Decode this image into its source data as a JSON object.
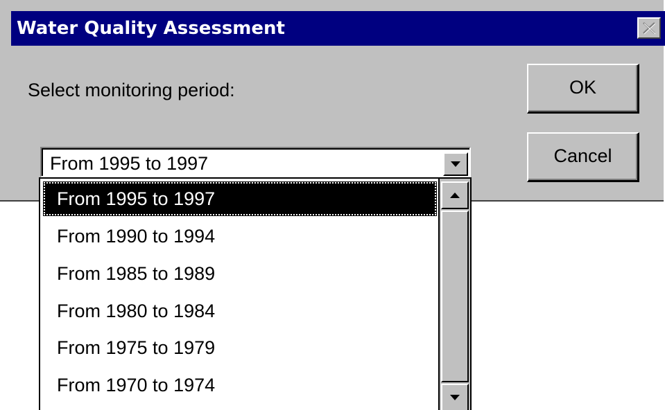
{
  "window": {
    "title": "Water Quality Assessment",
    "title_bar_color": "#000080",
    "close_icon": "close-icon"
  },
  "prompt": {
    "label": "Select monitoring period:"
  },
  "buttons": {
    "ok_label": "OK",
    "cancel_label": "Cancel"
  },
  "combo": {
    "selected_value": "From 1995 to 1997",
    "arrow_icon": "chevron-down-icon"
  },
  "dropdown": {
    "items": [
      {
        "label": "From 1995 to 1997",
        "selected": true
      },
      {
        "label": "From 1990 to 1994",
        "selected": false
      },
      {
        "label": "From 1985 to 1989",
        "selected": false
      },
      {
        "label": "From 1980 to 1984",
        "selected": false
      },
      {
        "label": "From 1975 to 1979",
        "selected": false
      },
      {
        "label": "From 1970 to 1974",
        "selected": false
      }
    ],
    "scroll_up_icon": "chevron-up-icon",
    "scroll_down_icon": "chevron-down-icon"
  }
}
